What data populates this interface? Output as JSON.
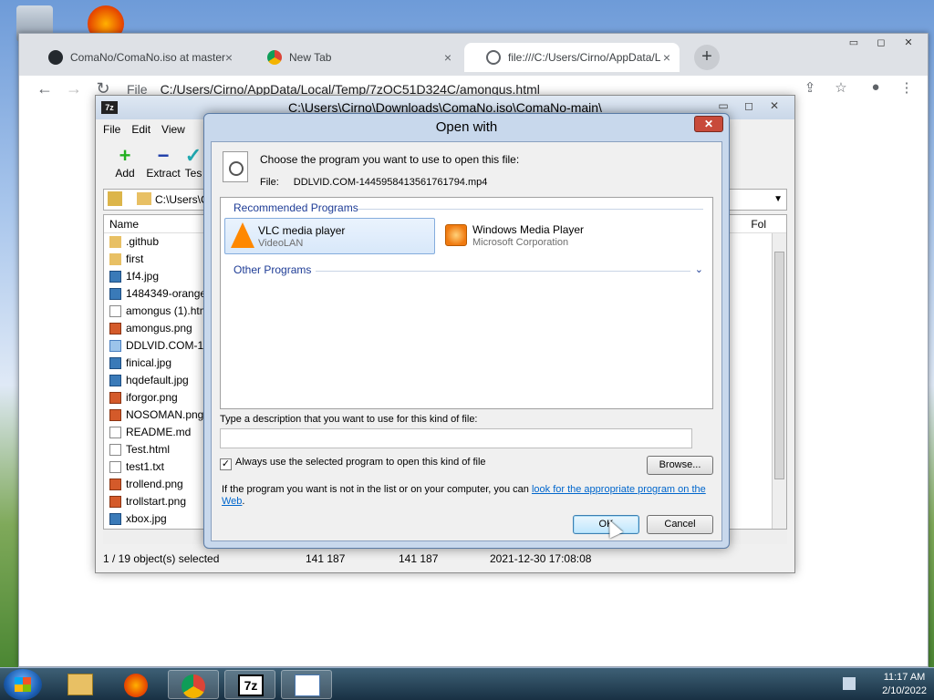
{
  "browser": {
    "tabs": [
      {
        "label": "ComaNo/ComaNo.iso at master",
        "close": "×"
      },
      {
        "label": "New Tab",
        "close": "×"
      },
      {
        "label": "file:///C:/Users/Cirno/AppData/L",
        "close": "×"
      }
    ],
    "new_tab": "+",
    "window_buttons": [
      "▭",
      "◻",
      "✕"
    ],
    "nav": {
      "back": "←",
      "forward": "→",
      "reload": "↻"
    },
    "omnibox": {
      "scheme_label": "File",
      "url": "C:/Users/Cirno/AppData/Local/Temp/7zOC51D324C/amongus.html"
    }
  },
  "sevenzip": {
    "title": "C:\\Users\\Cirno\\Downloads\\ComaNo.iso\\ComaNo-main\\",
    "menu": [
      "File",
      "Edit",
      "View"
    ],
    "toolbar": [
      {
        "label": "Add",
        "icon": "plus-icon",
        "color": "#22b020"
      },
      {
        "label": "Extract",
        "icon": "minus-icon",
        "color": "#1c3ca8"
      },
      {
        "label": "Tes",
        "icon": "check-icon",
        "color": "#20a8b0"
      }
    ],
    "address": "C:\\Users\\C",
    "column_name": "Name",
    "column_right": "Fol",
    "files": [
      {
        "name": ".github",
        "type": "folder"
      },
      {
        "name": "first",
        "type": "folder"
      },
      {
        "name": "1f4.jpg",
        "type": "img"
      },
      {
        "name": "1484349-orange",
        "type": "img"
      },
      {
        "name": "amongus (1).htm",
        "type": "doc"
      },
      {
        "name": "amongus.png",
        "type": "png"
      },
      {
        "name": "DDLVID.COM-14",
        "type": "blue"
      },
      {
        "name": "finical.jpg",
        "type": "img"
      },
      {
        "name": "hqdefault.jpg",
        "type": "img"
      },
      {
        "name": "iforgor.png",
        "type": "png"
      },
      {
        "name": "NOSOMAN.png",
        "type": "png"
      },
      {
        "name": "README.md",
        "type": "doc"
      },
      {
        "name": "Test.html",
        "type": "doc"
      },
      {
        "name": "test1.txt",
        "type": "doc"
      },
      {
        "name": "trollend.png",
        "type": "png"
      },
      {
        "name": "trollstart.png",
        "type": "png"
      },
      {
        "name": "xbox.jpg",
        "type": "img"
      }
    ],
    "status": {
      "selected": "1 / 19 object(s) selected",
      "size": "141 187",
      "packed": "141 187",
      "modified": "2021-12-30 17:08:08"
    }
  },
  "dialog": {
    "title": "Open with",
    "close": "✕",
    "prompt": "Choose the program you want to use to open this file:",
    "file_label": "File:",
    "file_name": "DDLVID.COM-1445958413561761794.mp4",
    "recommended_header": "Recommended Programs",
    "programs": [
      {
        "name": "VLC media player",
        "vendor": "VideoLAN"
      },
      {
        "name": "Windows Media Player",
        "vendor": "Microsoft Corporation"
      }
    ],
    "other_header": "Other Programs",
    "desc_label": "Type a description that you want to use for this kind of file:",
    "desc_value": "",
    "always_use_label": "Always use the selected program to open this kind of file",
    "always_use_checked": "✓",
    "browse": "Browse...",
    "info_text": "If the program you want is not in the list or on your computer, you can ",
    "info_link": "look for the appropriate program on the Web",
    "info_end": ".",
    "ok": "OK",
    "cancel": "Cancel"
  },
  "taskbar": {
    "time": "11:17 AM",
    "date": "2/10/2022",
    "sevenzip_label": "7z"
  },
  "colors": {
    "accent": "#1e3c96",
    "link": "#0066cc"
  }
}
